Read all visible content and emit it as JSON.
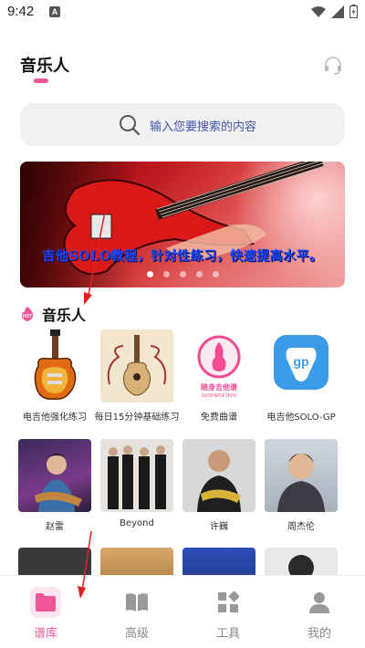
{
  "status_bar": {
    "time": "9:42",
    "notification": "A"
  },
  "header": {
    "title": "音乐人"
  },
  "search": {
    "placeholder": "输入您要搜索的内容"
  },
  "banner": {
    "caption": "吉他SOLO教程，针对性练习，快速提高水平。",
    "dot_count": 5,
    "active_dot": 0
  },
  "section": {
    "badge": "HOT",
    "title": "音乐人"
  },
  "grid": {
    "row1": [
      {
        "label": "电吉他强化练习",
        "icon": "electric-guitar-thumb"
      },
      {
        "label": "每日15分钟基础练习",
        "icon": "acoustic-guitar-thumb"
      },
      {
        "label": "免费曲谱",
        "icon": "guitar-tab-logo-thumb",
        "logo_text": "随身吉他谱",
        "logo_sub": "SUISHENJITAPU"
      },
      {
        "label": "电吉他SOLO-GP",
        "icon": "gp-app-thumb",
        "logo_text": "gp"
      }
    ],
    "row2": [
      {
        "label": "赵雷",
        "icon": "artist-photo"
      },
      {
        "label": "Beyond",
        "icon": "band-photo"
      },
      {
        "label": "许巍",
        "icon": "artist-photo"
      },
      {
        "label": "周杰伦",
        "icon": "artist-photo"
      }
    ]
  },
  "bottom_nav": {
    "items": [
      {
        "label": "谱库",
        "icon": "folder-icon",
        "active": true
      },
      {
        "label": "高级",
        "icon": "book-icon",
        "active": false
      },
      {
        "label": "工具",
        "icon": "tools-grid-icon",
        "active": false
      },
      {
        "label": "我的",
        "icon": "person-icon",
        "active": false
      }
    ]
  },
  "colors": {
    "accent": "#f0559a",
    "search_text": "#4055a8",
    "annotation_arrow": "#e02020"
  }
}
